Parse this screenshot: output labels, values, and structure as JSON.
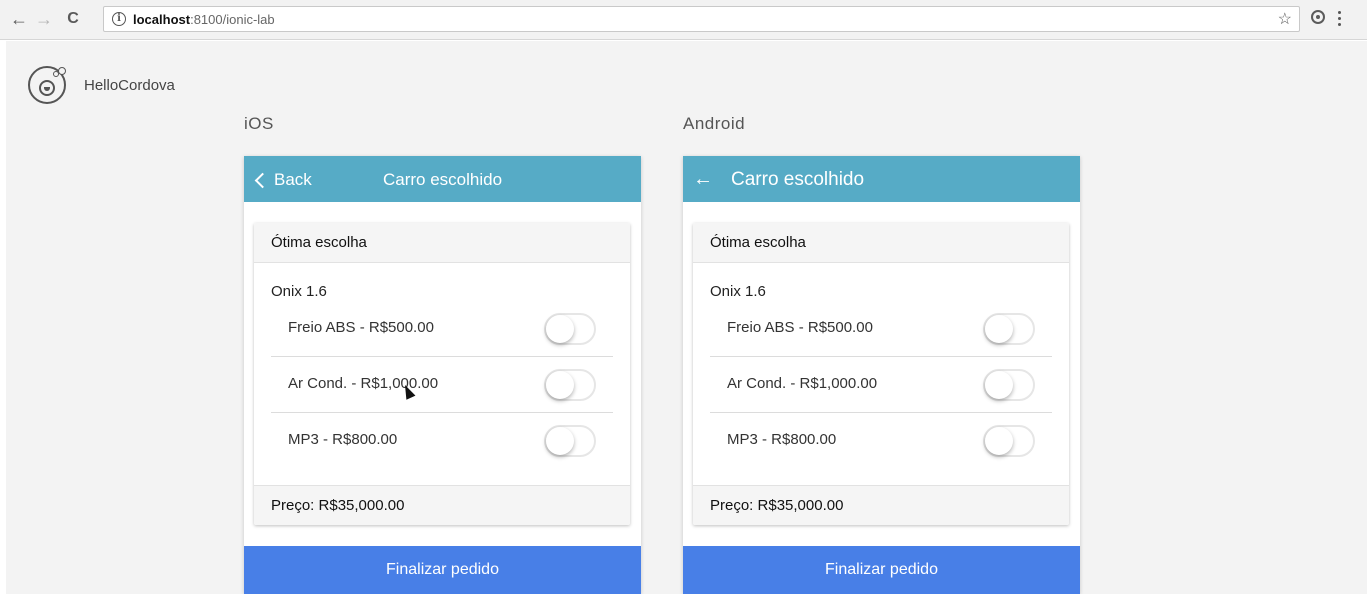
{
  "browser": {
    "back_icon": "arrow-left-icon",
    "back_glyph": "←",
    "forward_glyph": "→",
    "reload_glyph": "C",
    "url_host": "localhost",
    "url_rest": ":8100/ionic-lab",
    "star_glyph": "☆"
  },
  "app": {
    "brand_name": "HelloCordova"
  },
  "platforms": [
    {
      "label": "iOS",
      "back_label": "Back",
      "title": "Carro escolhido",
      "card_header": "Ótima escolha",
      "car_model": "Onix 1.6",
      "options": [
        {
          "label": "Freio ABS - R$500.00",
          "enabled": false
        },
        {
          "label": "Ar Cond. - R$1,000.00",
          "enabled": false
        },
        {
          "label": "MP3 - R$800.00",
          "enabled": false
        }
      ],
      "price": "Preço: R$35,000.00",
      "finish_label": "Finalizar pedido"
    },
    {
      "label": "Android",
      "back_glyph": "←",
      "title": "Carro escolhido",
      "card_header": "Ótima escolha",
      "car_model": "Onix 1.6",
      "options": [
        {
          "label": "Freio ABS - R$500.00",
          "enabled": false
        },
        {
          "label": "Ar Cond. - R$1,000.00",
          "enabled": false
        },
        {
          "label": "MP3 - R$800.00",
          "enabled": false
        }
      ],
      "price": "Preço: R$35,000.00",
      "finish_label": "Finalizar pedido"
    }
  ],
  "colors": {
    "header": "#56abc6",
    "button": "#487fe7"
  }
}
